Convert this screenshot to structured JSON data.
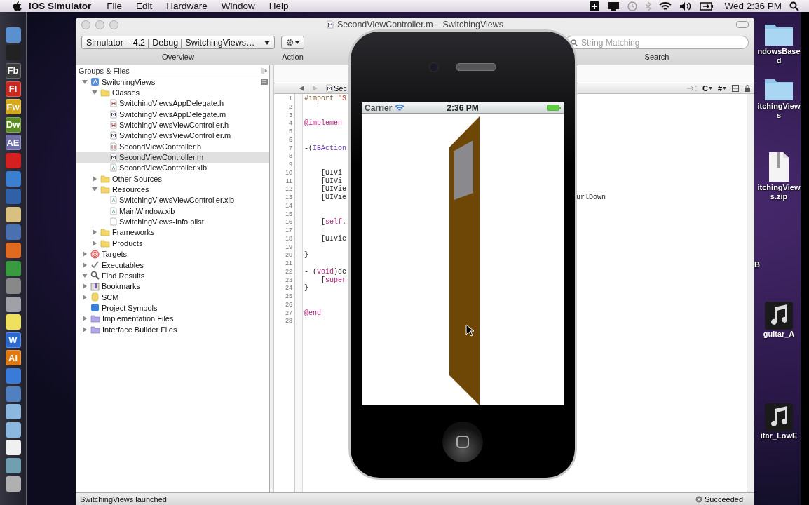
{
  "menu_bar": {
    "app": "iOS Simulator",
    "menus": [
      "File",
      "Edit",
      "Hardware",
      "Window",
      "Help"
    ],
    "clock": "Wed 2:36 PM"
  },
  "dock": [
    {
      "kind": "app",
      "color": "#5a8fd0"
    },
    {
      "kind": "app",
      "color": "#222222"
    },
    {
      "kind": "tile",
      "label": "Fb",
      "color": "#3b3b3b"
    },
    {
      "kind": "tile",
      "label": "Fl",
      "color": "#c8281e"
    },
    {
      "kind": "tile",
      "label": "Fw",
      "color": "#d4a91c"
    },
    {
      "kind": "tile",
      "label": "Dw",
      "color": "#5b8c23"
    },
    {
      "kind": "tile",
      "label": "AE",
      "color": "#6e6ea8"
    },
    {
      "kind": "app",
      "color": "#d42020"
    },
    {
      "kind": "app",
      "color": "#3a7fd0"
    },
    {
      "kind": "app",
      "color": "#3060a8"
    },
    {
      "kind": "app",
      "color": "#d8c080"
    },
    {
      "kind": "app",
      "color": "#4a70b0"
    },
    {
      "kind": "app",
      "color": "#e06a20"
    },
    {
      "kind": "app",
      "color": "#3a9a40"
    },
    {
      "kind": "app",
      "color": "#888888"
    },
    {
      "kind": "app",
      "color": "#a0a0a8"
    },
    {
      "kind": "app",
      "color": "#f0e060"
    },
    {
      "kind": "tile",
      "label": "W",
      "color": "#2a6ad0"
    },
    {
      "kind": "tile",
      "label": "Ai",
      "color": "#e07a10"
    },
    {
      "kind": "app",
      "color": "#3a7ad8"
    },
    {
      "kind": "app",
      "color": "#5080c0"
    },
    {
      "kind": "app",
      "color": "#8cb8e0"
    },
    {
      "kind": "app",
      "color": "#8cb8e0"
    },
    {
      "kind": "app",
      "color": "#f0f0f0"
    },
    {
      "kind": "app",
      "color": "#70a0b0"
    },
    {
      "kind": "app",
      "color": "#b0b0b0"
    }
  ],
  "desktop_icons": [
    {
      "kind": "folder",
      "label": "ndowsBased"
    },
    {
      "kind": "folder",
      "label": "itchingViews"
    },
    {
      "kind": "zip",
      "label": "itchingViews.zip"
    },
    {
      "kind": "none",
      "label": "B"
    },
    {
      "kind": "music",
      "label": "guitar_A"
    },
    {
      "kind": "music",
      "label": "itar_LowE"
    }
  ],
  "window": {
    "title": "SecondViewController.m – SwitchingViews",
    "toolbar": {
      "scheme": "Simulator – 4.2 | Debug | SwitchingViews…",
      "overview_label": "Overview",
      "action_label": "Action",
      "search_placeholder": "String Matching",
      "search_label": "Search"
    },
    "sidebar": {
      "header": "Groups & Files",
      "tree": [
        {
          "label": "SwitchingViews",
          "kind": "project",
          "expanded": true,
          "selected": false,
          "children": [
            {
              "label": "Classes",
              "kind": "folder",
              "expanded": true,
              "selected": false,
              "children": [
                {
                  "label": "SwitchingViewsAppDelegate.h",
                  "kind": "header",
                  "selected": false
                },
                {
                  "label": "SwitchingViewsAppDelegate.m",
                  "kind": "source",
                  "selected": false
                },
                {
                  "label": "SwitchingViewsViewController.h",
                  "kind": "header",
                  "selected": false
                },
                {
                  "label": "SwitchingViewsViewController.m",
                  "kind": "source",
                  "selected": false
                },
                {
                  "label": "SecondViewController.h",
                  "kind": "header",
                  "selected": false
                },
                {
                  "label": "SecondViewController.m",
                  "kind": "source",
                  "selected": true
                },
                {
                  "label": "SecondViewController.xib",
                  "kind": "xib",
                  "selected": false
                }
              ]
            },
            {
              "label": "Other Sources",
              "kind": "folder",
              "expanded": false,
              "selected": false
            },
            {
              "label": "Resources",
              "kind": "folder",
              "expanded": true,
              "selected": false,
              "children": [
                {
                  "label": "SwitchingViewsViewController.xib",
                  "kind": "xib",
                  "selected": false
                },
                {
                  "label": "MainWindow.xib",
                  "kind": "xib",
                  "selected": false
                },
                {
                  "label": "SwitchingViews-Info.plist",
                  "kind": "plist",
                  "selected": false
                }
              ]
            },
            {
              "label": "Frameworks",
              "kind": "folder",
              "expanded": false,
              "selected": false
            },
            {
              "label": "Products",
              "kind": "folder",
              "expanded": false,
              "selected": false
            }
          ]
        },
        {
          "label": "Targets",
          "kind": "target",
          "expanded": false,
          "selected": false
        },
        {
          "label": "Executables",
          "kind": "executable",
          "expanded": false,
          "selected": false
        },
        {
          "label": "Find Results",
          "kind": "find",
          "expanded": true,
          "selected": false
        },
        {
          "label": "Bookmarks",
          "kind": "bookmark",
          "expanded": false,
          "selected": false
        },
        {
          "label": "SCM",
          "kind": "scm",
          "expanded": false,
          "selected": false
        },
        {
          "label": "Project Symbols",
          "kind": "symbols",
          "selected": false
        },
        {
          "label": "Implementation Files",
          "kind": "smart",
          "expanded": false,
          "selected": false
        },
        {
          "label": "Interface Builder Files",
          "kind": "smart",
          "expanded": false,
          "selected": false
        }
      ]
    },
    "editor": {
      "file_tab": "Sec",
      "menus": [
        "C",
        "#"
      ],
      "lines": [
        {
          "n": "1",
          "segments": [
            {
              "kind": "directive",
              "text": "#import"
            },
            {
              "kind": "string",
              "text": " \"S"
            }
          ]
        },
        {
          "n": "2"
        },
        {
          "n": "3"
        },
        {
          "n": "4",
          "segments": [
            {
              "kind": "keyword",
              "text": "@implemen"
            }
          ]
        },
        {
          "n": "5"
        },
        {
          "n": "6"
        },
        {
          "n": "7",
          "segments": [
            {
              "kind": "plain",
              "text": "-("
            },
            {
              "kind": "type",
              "text": "IBAction"
            }
          ]
        },
        {
          "n": "8"
        },
        {
          "n": "9"
        },
        {
          "n": "10",
          "segments": [
            {
              "kind": "plain",
              "text": "    [UIVi"
            }
          ]
        },
        {
          "n": "11",
          "segments": [
            {
              "kind": "plain",
              "text": "    [UIVi"
            }
          ]
        },
        {
          "n": "12",
          "segments": [
            {
              "kind": "plain",
              "text": "    [UIVie"
            }
          ]
        },
        {
          "n": "13",
          "segments": [
            {
              "kind": "plain",
              "text": "    [UIVie"
            },
            {
              "kind": "tail",
              "text": "urlDown"
            }
          ]
        },
        {
          "n": "14"
        },
        {
          "n": "15"
        },
        {
          "n": "16",
          "segments": [
            {
              "kind": "plain",
              "text": "    ["
            },
            {
              "kind": "keyword",
              "text": "self"
            },
            {
              "kind": "plain",
              "text": "."
            }
          ]
        },
        {
          "n": "17"
        },
        {
          "n": "18",
          "segments": [
            {
              "kind": "plain",
              "text": "    [UIVie"
            }
          ]
        },
        {
          "n": "19"
        },
        {
          "n": "20",
          "segments": [
            {
              "kind": "plain",
              "text": "}"
            }
          ]
        },
        {
          "n": "21"
        },
        {
          "n": "22",
          "segments": [
            {
              "kind": "plain",
              "text": "- ("
            },
            {
              "kind": "keyword",
              "text": "void"
            },
            {
              "kind": "plain",
              "text": ")de"
            }
          ]
        },
        {
          "n": "23",
          "segments": [
            {
              "kind": "plain",
              "text": "    ["
            },
            {
              "kind": "keyword",
              "text": "super"
            }
          ]
        },
        {
          "n": "24",
          "segments": [
            {
              "kind": "plain",
              "text": "}"
            }
          ]
        },
        {
          "n": "25"
        },
        {
          "n": "26"
        },
        {
          "n": "27",
          "segments": [
            {
              "kind": "keyword",
              "text": "@end"
            }
          ]
        },
        {
          "n": "28"
        }
      ]
    },
    "status": {
      "message": "SwitchingViews launched",
      "result": "Succeeded"
    }
  },
  "phone": {
    "carrier": "Carrier",
    "time": "2:36 PM"
  }
}
